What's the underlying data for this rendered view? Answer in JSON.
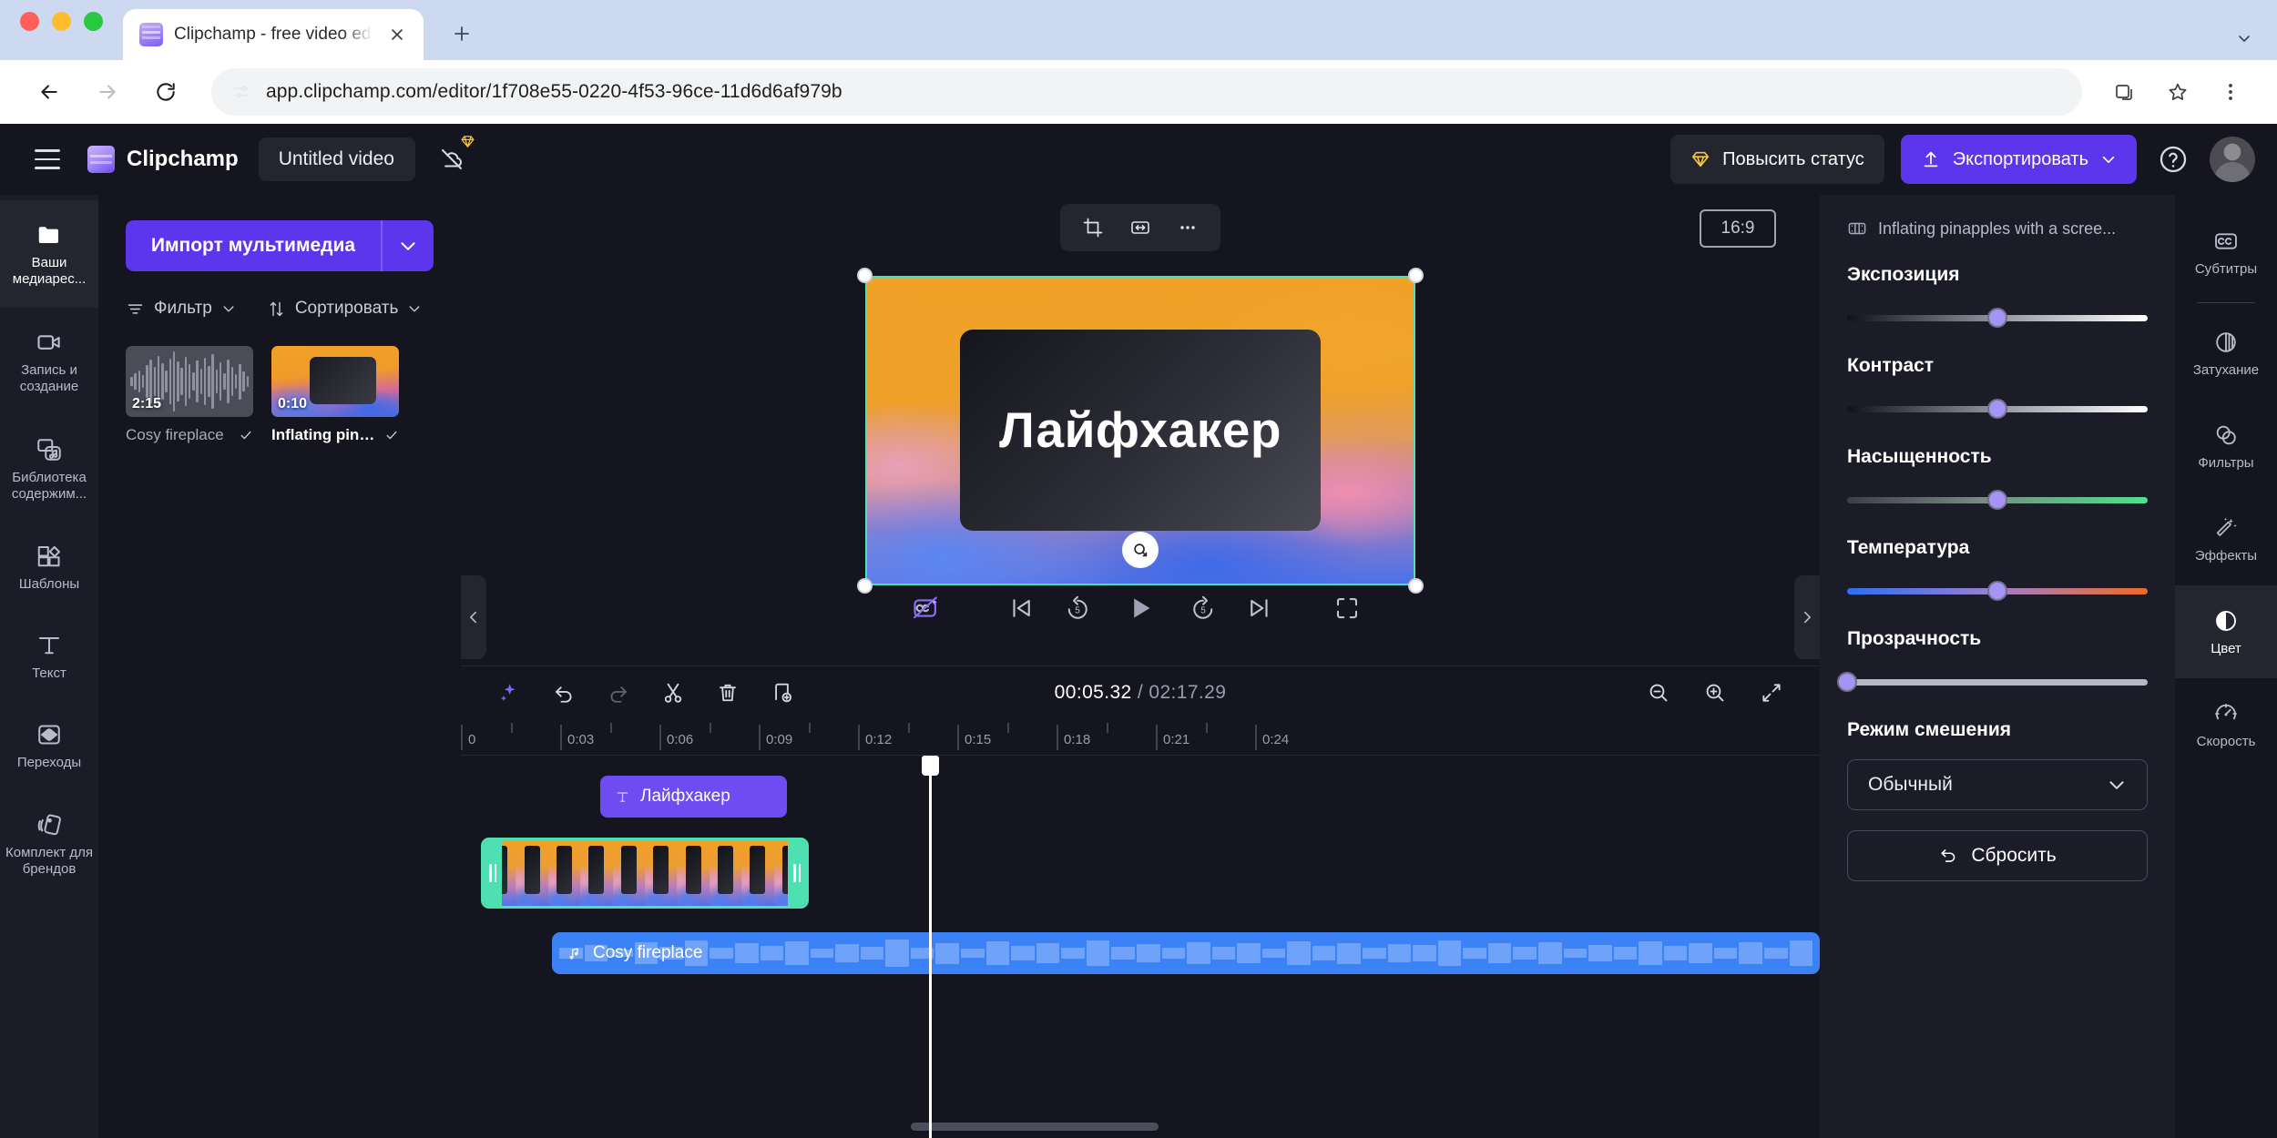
{
  "browser": {
    "tab": {
      "title": "Clipchamp - free video editor",
      "favicon_icon": "clipchamp-favicon",
      "close_icon": "close-icon"
    },
    "new_tab_icon": "plus-icon",
    "window_menu_icon": "chevron-down-icon",
    "nav": {
      "back_icon": "back-arrow-icon",
      "forward_icon": "forward-arrow-icon",
      "reload_icon": "reload-icon"
    },
    "omnibox": {
      "site_info_icon": "tune-icon",
      "url": "app.clipchamp.com/editor/1f708e55-0220-4f53-96ce-11d6d6af979b"
    },
    "toolbar": {
      "install_icon": "install-app-icon",
      "bookmark_icon": "star-icon",
      "menu_icon": "kebab-menu-icon"
    }
  },
  "header": {
    "menu_icon": "hamburger-icon",
    "brand": "Clipchamp",
    "project_title": "Untitled video",
    "cloud_icon": "cloud-off-icon",
    "gem_icon": "diamond-icon",
    "upgrade_label": "Повысить статус",
    "upgrade_icon": "diamond-icon",
    "export_label": "Экспортировать",
    "export_icon": "upload-icon",
    "export_caret_icon": "chevron-down-icon",
    "help_icon": "help-circle-icon",
    "avatar_name": "avatar"
  },
  "rail": {
    "items": [
      {
        "label": "Ваши медиарес...",
        "icon": "folder-icon",
        "active": true
      },
      {
        "label": "Запись и создание",
        "icon": "video-camera-icon",
        "active": false
      },
      {
        "label": "Библиотека содержим...",
        "icon": "content-library-icon",
        "active": false
      },
      {
        "label": "Шаблоны",
        "icon": "templates-icon",
        "active": false
      },
      {
        "label": "Текст",
        "icon": "text-icon",
        "active": false
      },
      {
        "label": "Переходы",
        "icon": "transitions-icon",
        "active": false
      },
      {
        "label": "Комплект для брендов",
        "icon": "brand-kit-icon",
        "active": false
      }
    ]
  },
  "media_panel": {
    "import_label": "Импорт мультимедиа",
    "import_caret_icon": "chevron-down-icon",
    "filter_label": "Фильтр",
    "filter_icon": "filter-icon",
    "sort_label": "Сортировать",
    "sort_icon": "sort-arrows-icon",
    "items": [
      {
        "name": "Cosy fireplace",
        "duration": "2:15",
        "type": "audio",
        "selected": false,
        "check_icon": "check-icon"
      },
      {
        "name": "Inflating pina...",
        "duration": "0:10",
        "type": "video",
        "selected": true,
        "check_icon": "check-icon"
      }
    ]
  },
  "stage": {
    "float_toolbar": [
      {
        "icon": "crop-icon"
      },
      {
        "icon": "fit-width-icon"
      },
      {
        "icon": "more-horizontal-icon"
      }
    ],
    "aspect_ratio": "16:9",
    "overlay_text": "Лайфхакер",
    "rotate_icon": "rotate-handle-icon",
    "controls": {
      "magic_icon": "auto-captions-off-icon",
      "prev_icon": "skip-previous-icon",
      "back5_icon": "rewind-5-icon",
      "play_icon": "play-icon",
      "fwd5_icon": "forward-5-icon",
      "next_icon": "skip-next-icon",
      "fullscreen_icon": "fullscreen-icon"
    },
    "collapse_left_icon": "chevron-left-icon",
    "collapse_right_icon": "chevron-right-icon"
  },
  "timeline": {
    "toolbar": [
      {
        "icon": "sparkle-icon",
        "name": "ai-tools-button"
      },
      {
        "icon": "undo-icon",
        "name": "undo-button"
      },
      {
        "icon": "redo-icon",
        "name": "redo-button"
      },
      {
        "icon": "scissors-icon",
        "name": "split-button"
      },
      {
        "icon": "trash-icon",
        "name": "delete-button"
      },
      {
        "icon": "duplicate-icon",
        "name": "duplicate-button"
      }
    ],
    "current_time": "00:05.32",
    "separator": "/",
    "total_time": "02:17.29",
    "zoom_out_icon": "zoom-out-icon",
    "zoom_in_icon": "zoom-in-icon",
    "fit_icon": "fit-timeline-icon",
    "ruler_ticks": [
      "0",
      "0:03",
      "0:06",
      "0:09",
      "0:12",
      "0:15",
      "0:18",
      "0:21",
      "0:24"
    ],
    "clips": {
      "text_clip": {
        "label": "Лайфхакер",
        "icon": "text-icon"
      },
      "video_clip": {
        "label": "",
        "trim_handle_icon": "trim-handle-icon"
      },
      "audio_clip": {
        "label": "Cosy fireplace",
        "icon": "music-note-icon"
      }
    },
    "collapse_chevron_icon": "chevron-down-icon"
  },
  "inspector": {
    "clip_name": "Inflating pinapples with a scree...",
    "clip_icon": "film-icon",
    "controls": [
      {
        "label": "Экспозиция",
        "name": "exposure",
        "track": "tr-exposure",
        "value_pct": 50
      },
      {
        "label": "Контраст",
        "name": "contrast",
        "track": "tr-contrast",
        "value_pct": 50
      },
      {
        "label": "Насыщенность",
        "name": "saturation",
        "track": "tr-saturation",
        "value_pct": 50
      },
      {
        "label": "Температура",
        "name": "temperature",
        "track": "tr-temperature",
        "value_pct": 50
      },
      {
        "label": "Прозрачность",
        "name": "opacity",
        "track": "tr-opacity",
        "value_pct": 0
      }
    ],
    "blend_label": "Режим смешения",
    "blend_value": "Обычный",
    "blend_caret_icon": "chevron-down-icon",
    "reset_label": "Сбросить",
    "reset_icon": "undo-arrow-icon"
  },
  "tabrail": {
    "items": [
      {
        "label": "Субтитры",
        "icon": "closed-captions-icon",
        "active": false,
        "sep_after": true
      },
      {
        "label": "Затухание",
        "icon": "fade-icon",
        "active": false
      },
      {
        "label": "Фильтры",
        "icon": "filters-icon",
        "active": false
      },
      {
        "label": "Эффекты",
        "icon": "effects-wand-icon",
        "active": false
      },
      {
        "label": "Цвет",
        "icon": "color-contrast-icon",
        "active": true
      },
      {
        "label": "Скорость",
        "icon": "speed-gauge-icon",
        "active": false
      }
    ]
  },
  "colors": {
    "accent": "#5b36ec",
    "selection": "#4ee0b0",
    "audio_clip": "#3b82f6",
    "panel_bg": "#1b1c28",
    "app_bg": "#14151f"
  }
}
